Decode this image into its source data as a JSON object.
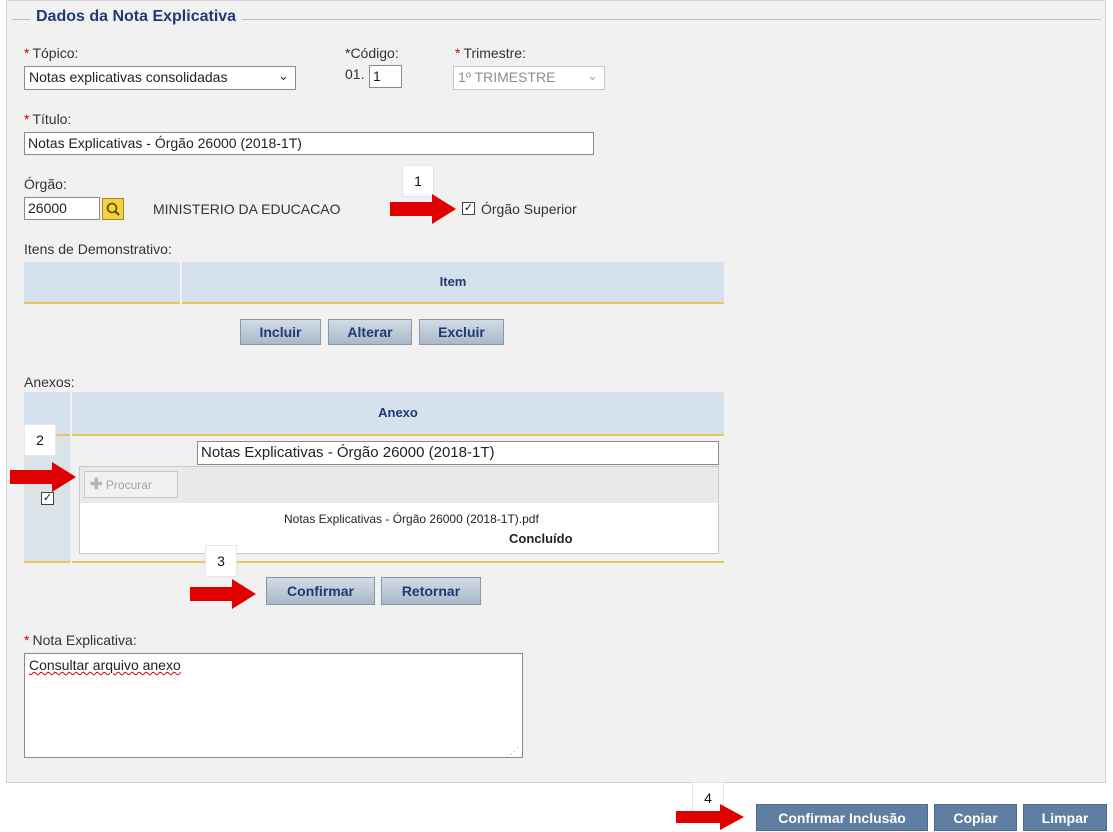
{
  "section": {
    "title": "Dados da Nota Explicativa"
  },
  "topico": {
    "label": "Tópico:",
    "value": "Notas explicativas consolidadas"
  },
  "codigo": {
    "label": "*Código:",
    "prefix": "01.",
    "value": "1"
  },
  "trimestre": {
    "label": "Trimestre:",
    "value": "1º TRIMESTRE"
  },
  "titulo": {
    "label": "Título:",
    "value": "Notas Explicativas - Órgão 26000 (2018-1T)"
  },
  "orgao": {
    "label": "Órgão:",
    "code": "26000",
    "name": "MINISTERIO DA EDUCACAO",
    "superior_label": "Órgão Superior",
    "superior_checked": true
  },
  "itens": {
    "label": "Itens de Demonstrativo:",
    "column": "Item",
    "buttons": {
      "incluir": "Incluir",
      "alterar": "Alterar",
      "excluir": "Excluir"
    }
  },
  "anexos": {
    "label": "Anexos:",
    "column": "Anexo",
    "row": {
      "checked": true,
      "title": "Notas Explicativas - Órgão 26000 (2018-1T)",
      "browse_label": "Procurar",
      "file_name": "Notas Explicativas - Órgão 26000 (2018-1T).pdf",
      "status": "Concluído"
    },
    "buttons": {
      "confirmar": "Confirmar",
      "retornar": "Retornar"
    }
  },
  "nota": {
    "label": "Nota Explicativa:",
    "text": "Consultar arquivo anexo"
  },
  "footer": {
    "confirmar_inclusao": "Confirmar Inclusão",
    "copiar": "Copiar",
    "limpar": "Limpar"
  },
  "annotations": {
    "m1": "1",
    "m2": "2",
    "m3": "3",
    "m4": "4"
  },
  "colors": {
    "arrow": "#e00000",
    "header": "#1f3a73",
    "table_head": "#d5e2ee",
    "accent_line": "#e8c65b"
  }
}
